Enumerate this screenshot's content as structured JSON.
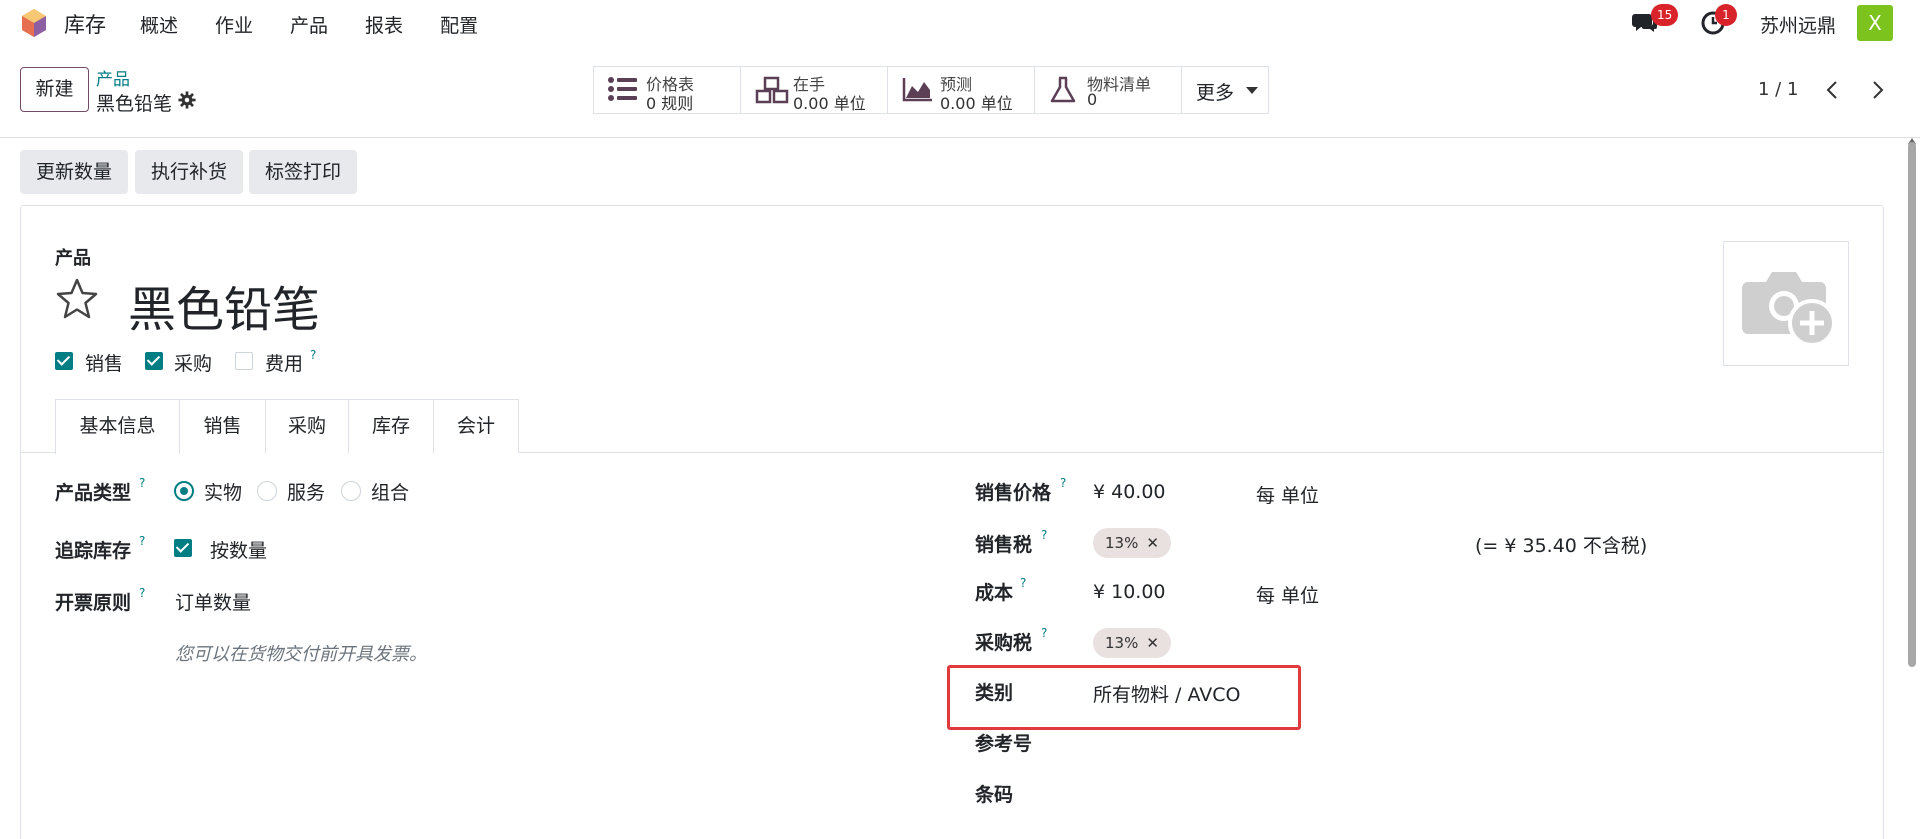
{
  "navbar": {
    "app_name": "库存",
    "menu": [
      "概述",
      "作业",
      "产品",
      "报表",
      "配置"
    ],
    "messages_count": "15",
    "activities_count": "1",
    "company": "苏州远鼎",
    "avatar_letter": "X"
  },
  "control_panel": {
    "new_button": "新建",
    "breadcrumb_parent": "产品",
    "breadcrumb_current": "黑色铅笔",
    "smart_buttons": [
      {
        "label": "价格表",
        "value": "0 规则"
      },
      {
        "label": "在手",
        "value": "0.00 单位"
      },
      {
        "label": "预测",
        "value": "0.00 单位"
      },
      {
        "label": "物料清单",
        "value": "0"
      }
    ],
    "more": "更多",
    "pager": "1 / 1"
  },
  "actions": [
    "更新数量",
    "执行补货",
    "标签打印"
  ],
  "form": {
    "product_label": "产品",
    "name": "黑色铅笔",
    "can_sell": "销售",
    "can_purchase": "采购",
    "expense": "费用",
    "help_mark": "?",
    "tabs": [
      "基本信息",
      "销售",
      "采购",
      "库存",
      "会计"
    ],
    "product_type_label": "产品类型",
    "type_options": [
      "实物",
      "服务",
      "组合"
    ],
    "track_label": "追踪库存",
    "track_value": "按数量",
    "invoice_label": "开票原则",
    "invoice_value": "订单数量",
    "invoice_hint": "您可以在货物交付前开具发票。",
    "sale_price_label": "销售价格",
    "sale_price": "¥ 40.00",
    "per_unit": "每 单位",
    "sale_tax_label": "销售税",
    "sale_tax_tag": "13%",
    "tax_excluded": "(= ¥ 35.40 不含税)",
    "cost_label": "成本",
    "cost": "¥ 10.00",
    "purchase_tax_label": "采购税",
    "purchase_tax_tag": "13%",
    "category_label": "类别",
    "category_value": "所有物料 / AVCO",
    "reference_label": "参考号",
    "barcode_label": "条码"
  },
  "colors": {
    "accent": "#017e84",
    "brand": "#714b67",
    "highlight": "#e0393e"
  }
}
